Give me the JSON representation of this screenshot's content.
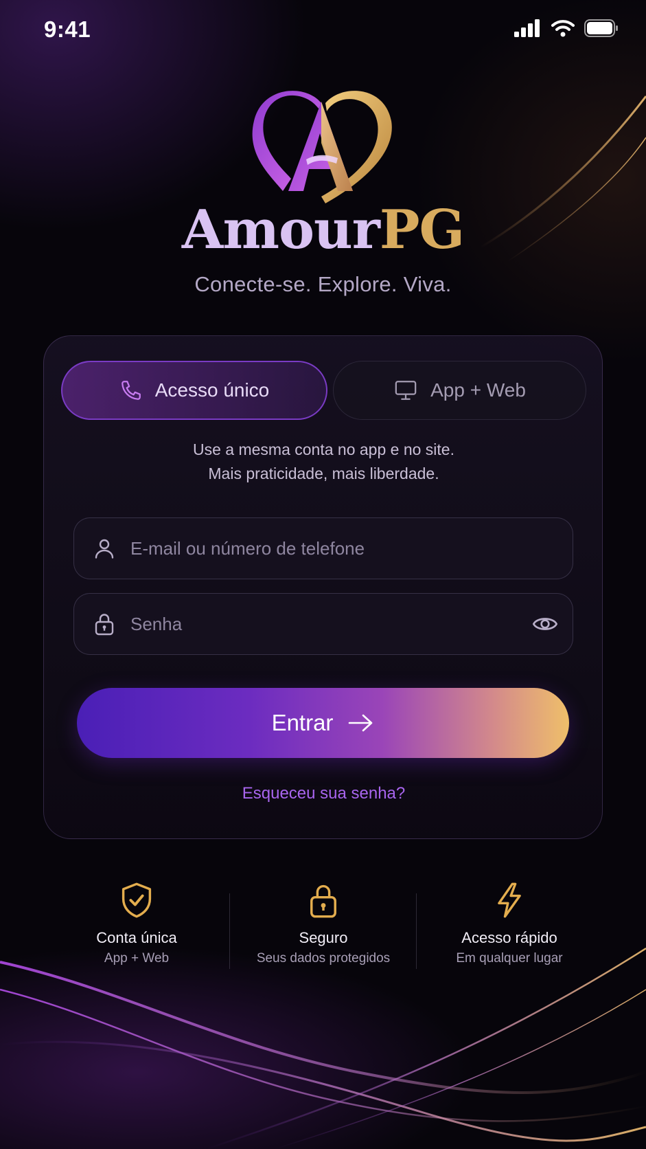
{
  "status_bar": {
    "time": "9:41",
    "icons": [
      "signal-icon",
      "wifi-icon",
      "battery-icon"
    ]
  },
  "brand": {
    "logo_icon": "heart-a-logo-icon",
    "name_part1": "Amour",
    "name_part2": "PG",
    "tagline": "Conecte-se. Explore. Viva.",
    "colors": {
      "purple": "#c45ce8",
      "gold": "#d8ab5e"
    }
  },
  "tabs": [
    {
      "label": "Acesso único",
      "icon": "phone-icon",
      "active": true
    },
    {
      "label": "App + Web",
      "icon": "monitor-icon",
      "active": false
    }
  ],
  "description": {
    "line1": "Use a mesma conta no app e no site.",
    "line2": "Mais praticidade, mais liberdade."
  },
  "form": {
    "email": {
      "placeholder": "E-mail ou número de telefone",
      "value": "",
      "icon": "user-icon"
    },
    "password": {
      "placeholder": "Senha",
      "value": "",
      "icon": "lock-icon",
      "toggle_icon": "eye-icon"
    },
    "submit_label": "Entrar",
    "submit_icon": "arrow-right-icon",
    "forgot_label": "Esqueceu sua senha?"
  },
  "features": [
    {
      "title": "Conta única",
      "subtitle": "App + Web",
      "icon": "shield-check-icon"
    },
    {
      "title": "Seguro",
      "subtitle": "Seus dados protegidos",
      "icon": "lock-icon"
    },
    {
      "title": "Acesso rápido",
      "subtitle": "Em qualquer lugar",
      "icon": "lightning-icon"
    }
  ],
  "accent_colors": {
    "button_start": "#4a1fb6",
    "button_end": "#efbf6a",
    "link": "#a865ee",
    "feature_icon": "#e3ad4e"
  }
}
